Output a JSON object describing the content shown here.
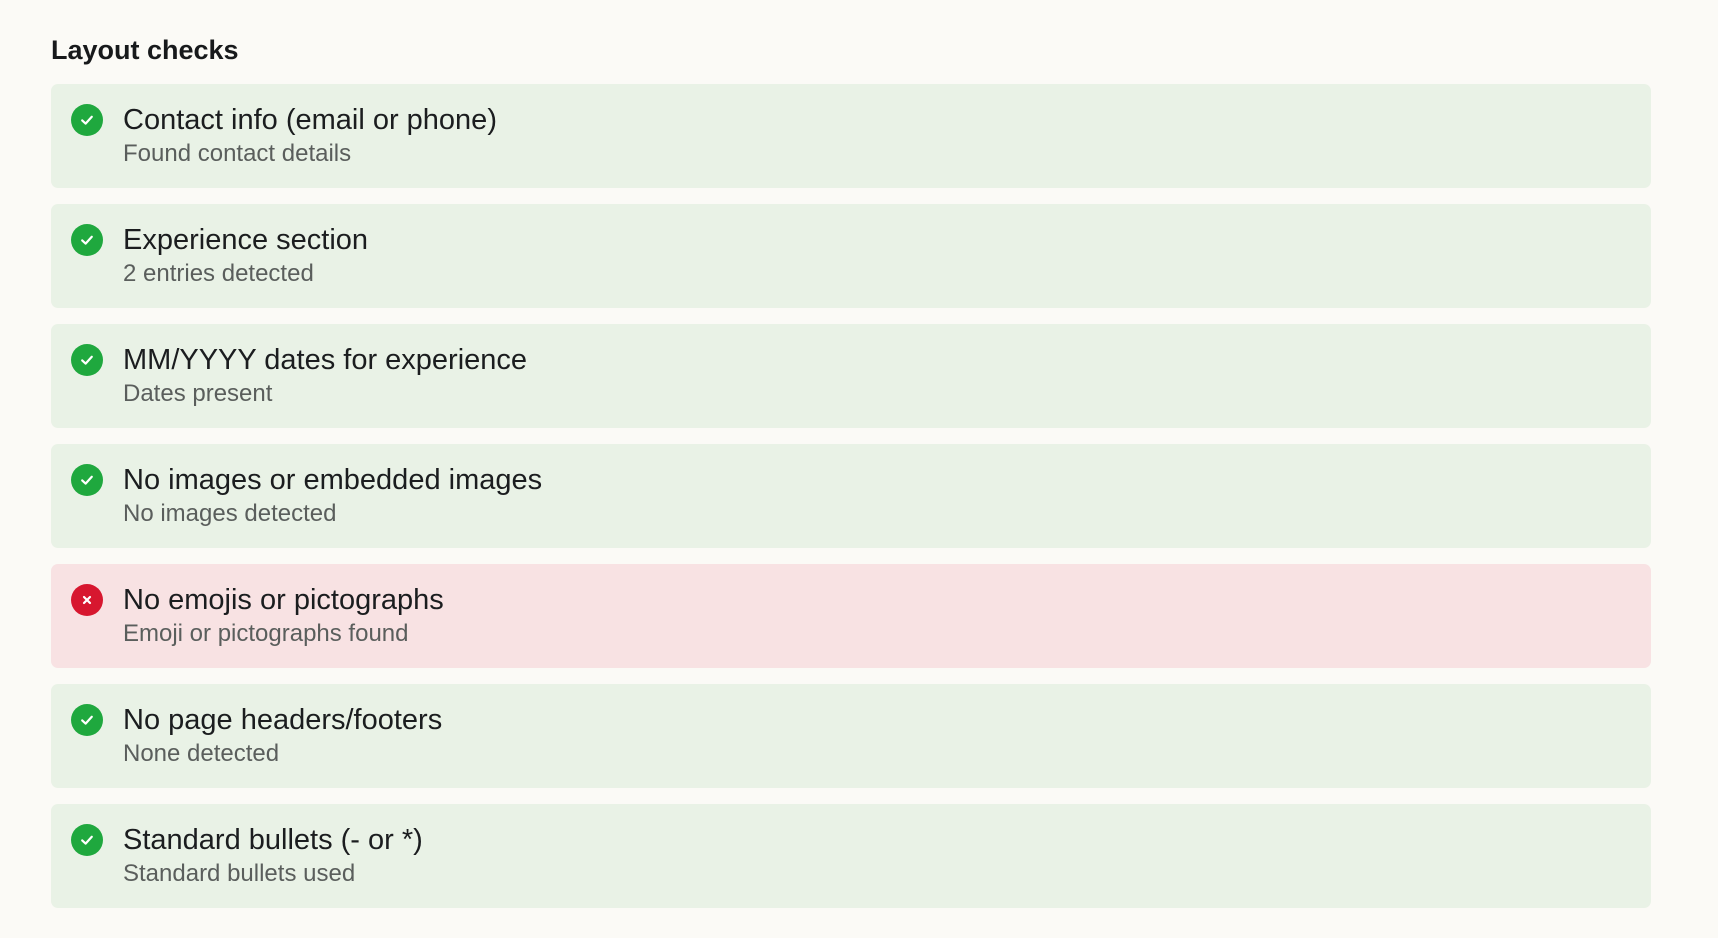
{
  "section": {
    "title": "Layout checks"
  },
  "colors": {
    "page_background": "#fbfaf6",
    "pass_background": "#e9f2e6",
    "fail_background": "#f8e2e3",
    "pass_icon": "#1fa83e",
    "fail_icon": "#d7172f"
  },
  "checks": [
    {
      "title": "Contact info (email or phone)",
      "detail": "Found contact details",
      "status": "pass",
      "icon": "check-circle-icon"
    },
    {
      "title": "Experience section",
      "detail": "2 entries detected",
      "status": "pass",
      "icon": "check-circle-icon"
    },
    {
      "title": "MM/YYYY dates for experience",
      "detail": "Dates present",
      "status": "pass",
      "icon": "check-circle-icon"
    },
    {
      "title": "No images or embedded images",
      "detail": "No images detected",
      "status": "pass",
      "icon": "check-circle-icon"
    },
    {
      "title": "No emojis or pictographs",
      "detail": "Emoji or pictographs found",
      "status": "fail",
      "icon": "x-circle-icon"
    },
    {
      "title": "No page headers/footers",
      "detail": "None detected",
      "status": "pass",
      "icon": "check-circle-icon"
    },
    {
      "title": "Standard bullets (- or *)",
      "detail": "Standard bullets used",
      "status": "pass",
      "icon": "check-circle-icon"
    }
  ]
}
